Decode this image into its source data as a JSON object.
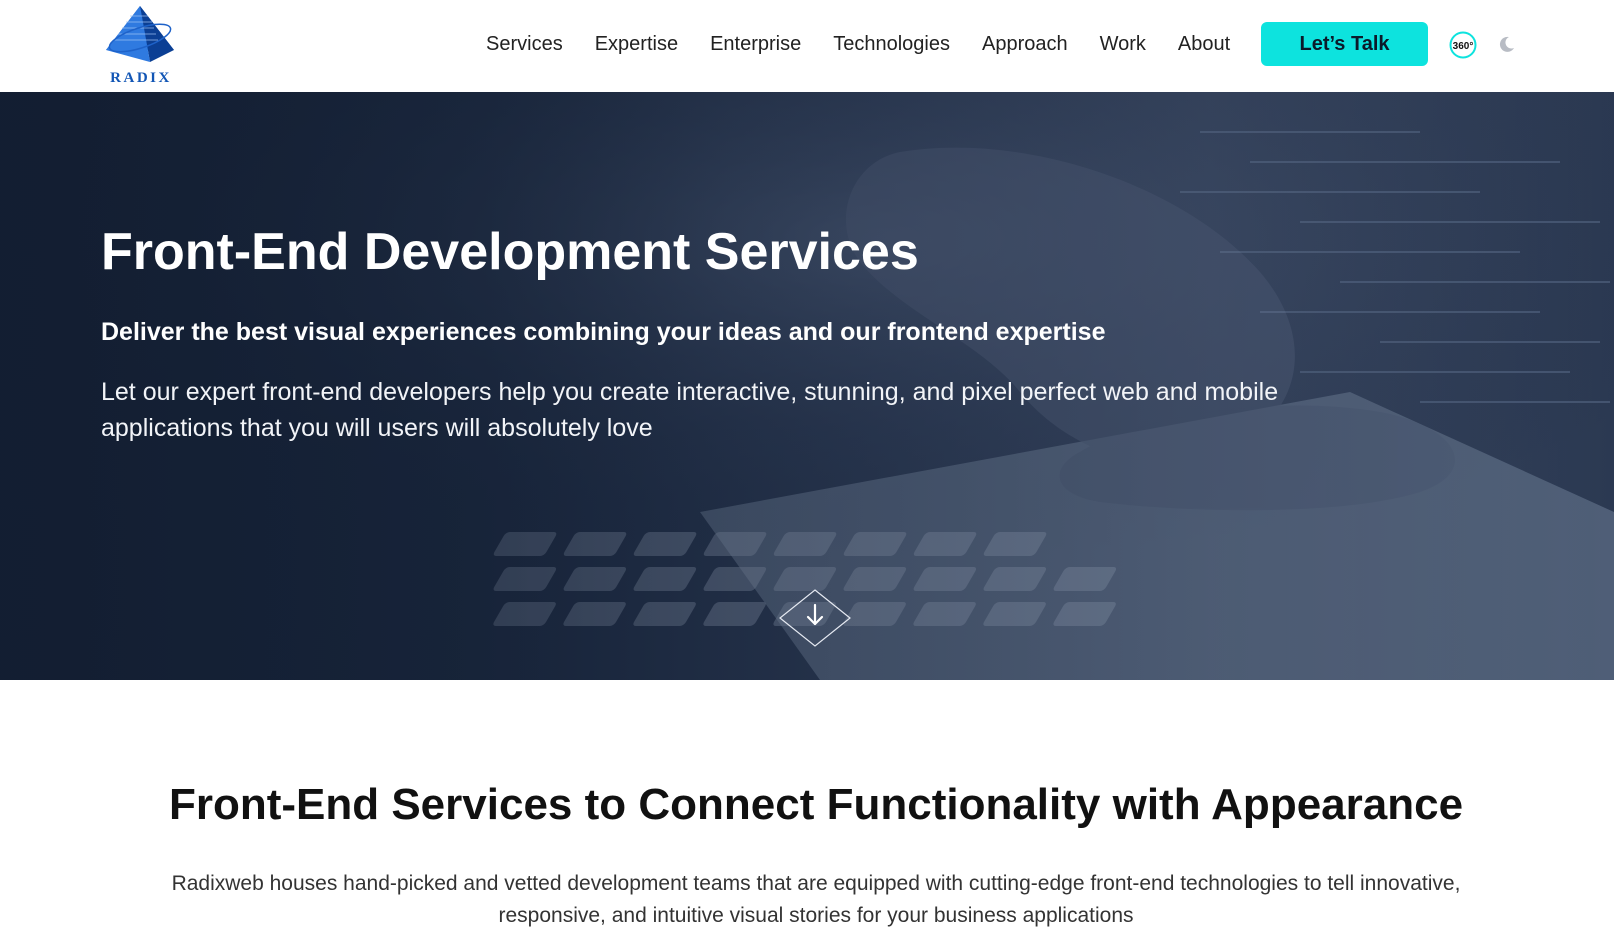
{
  "header": {
    "logo_text": "RADIX",
    "nav": [
      {
        "label": "Services"
      },
      {
        "label": "Expertise"
      },
      {
        "label": "Enterprise"
      },
      {
        "label": "Technologies"
      },
      {
        "label": "Approach"
      },
      {
        "label": "Work"
      },
      {
        "label": "About"
      }
    ],
    "cta_label": "Let’s Talk",
    "view_360_label": "360°",
    "accent_color": "#0de3de",
    "logo_color": "#1256b5"
  },
  "hero": {
    "title": "Front-End Development Services",
    "subtitle": "Deliver the best visual experiences combining your ideas and our frontend expertise",
    "description": "Let our expert front-end developers help you create interactive, stunning, and pixel perfect web and mobile applications that you will users will absolutely love",
    "scroll_icon": "arrow-down-icon"
  },
  "section": {
    "title": "Front-End Services to Connect Functionality with Appearance",
    "description": "Radixweb houses hand-picked and vetted development teams that are equipped with cutting-edge front-end technologies to tell innovative, responsive, and intuitive visual stories for your business applications"
  }
}
